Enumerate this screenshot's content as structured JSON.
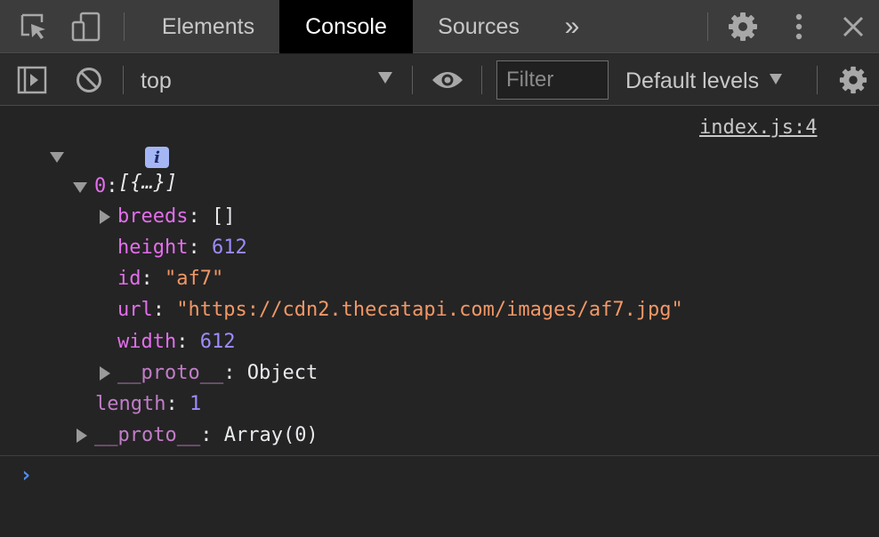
{
  "devtools": {
    "tabs": [
      {
        "label": "Elements",
        "active": false
      },
      {
        "label": "Console",
        "active": true
      },
      {
        "label": "Sources",
        "active": false
      }
    ],
    "more_tabs_label": "»",
    "icons": [
      "inspect-element-icon",
      "device-toolbar-icon",
      "settings-gear-icon",
      "more-vertical-icon",
      "close-icon"
    ]
  },
  "toolbar": {
    "context": "top",
    "filter_placeholder": "Filter",
    "levels_label": "Default levels",
    "icons": [
      "sidebar-toggle-icon",
      "clear-console-icon",
      "live-expression-eye-icon",
      "console-settings-gear-icon"
    ]
  },
  "console": {
    "source": "index.js:4",
    "array_summary": "[{…}]",
    "info_badge": "i",
    "index_key": "0",
    "props": {
      "breeds_key": "breeds",
      "breeds_value": "[]",
      "height_key": "height",
      "height_value": "612",
      "id_key": "id",
      "id_value": "\"af7\"",
      "url_key": "url",
      "url_value": "\"https://cdn2.thecatapi.com/images/af7.jpg\"",
      "width_key": "width",
      "width_value": "612",
      "proto_key": "__proto__",
      "proto_value": "Object"
    },
    "length_key": "length",
    "length_value": "1",
    "array_proto_key": "__proto__",
    "array_proto_value": "Array(0)",
    "prompt": "›"
  },
  "colors": {
    "active_tab_bg": "#000000",
    "key": "#e36eec",
    "number": "#9e8bff",
    "string": "#f29766",
    "prompt": "#4d8ef5"
  }
}
